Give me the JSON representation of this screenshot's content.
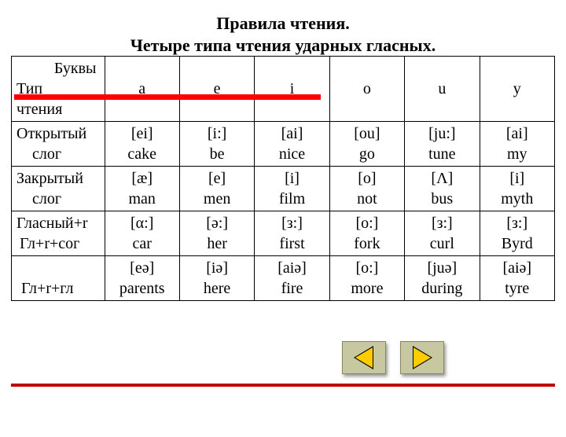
{
  "title_line1": "Правила чтения.",
  "title_line2": "Четыре типа чтения ударных гласных.",
  "header": {
    "corner_l1": "Буквы",
    "corner_l2": "Тип",
    "corner_l3": "чтения",
    "vowels": [
      "a",
      "e",
      "i",
      "o",
      "u",
      "y"
    ]
  },
  "rows": [
    {
      "label_l1": "Открытый",
      "label_l2": "слог",
      "cells": [
        {
          "ipa": "[ei]",
          "ex": "cake"
        },
        {
          "ipa": "[i:]",
          "ex": "be"
        },
        {
          "ipa": "[ai]",
          "ex": "nice"
        },
        {
          "ipa": "[ou]",
          "ex": "go"
        },
        {
          "ipa": "[ju:]",
          "ex": "tune"
        },
        {
          "ipa": "[ai]",
          "ex": "my"
        }
      ]
    },
    {
      "label_l1": "Закрытый",
      "label_l2": "слог",
      "cells": [
        {
          "ipa": "[æ]",
          "ex": "man"
        },
        {
          "ipa": "[e]",
          "ex": "men"
        },
        {
          "ipa": "[i]",
          "ex": "film"
        },
        {
          "ipa": "[o]",
          "ex": "not"
        },
        {
          "ipa": "[Λ]",
          "ex": "bus"
        },
        {
          "ipa": "[i]",
          "ex": "myth"
        }
      ]
    },
    {
      "label_l1": "Гласный+r",
      "label_l2": "Гл+r+сог",
      "cells": [
        {
          "ipa": "[α:]",
          "ex": "car"
        },
        {
          "ipa": "[ə:]",
          "ex": "her"
        },
        {
          "ipa": "[з:]",
          "ex": "first"
        },
        {
          "ipa": "[o:]",
          "ex": "fork"
        },
        {
          "ipa": "[з:]",
          "ex": "curl"
        },
        {
          "ipa": "[з:]",
          "ex": "Byrd"
        }
      ]
    },
    {
      "label_l1": "",
      "label_l2": "Гл+r+гл",
      "cells": [
        {
          "ipa": "[eә]",
          "ex": "parents"
        },
        {
          "ipa": "[iә]",
          "ex": "here"
        },
        {
          "ipa": "[aiә]",
          "ex": "fire"
        },
        {
          "ipa": "[o:]",
          "ex": "more"
        },
        {
          "ipa": "[juә]",
          "ex": "during"
        },
        {
          "ipa": "[aiә]",
          "ex": "tyre"
        }
      ]
    }
  ],
  "chart_data": {
    "type": "table",
    "title": "Правила чтения. Четыре типа чтения ударных гласных.",
    "columns": [
      "Тип чтения / Буквы",
      "a",
      "e",
      "i",
      "o",
      "u",
      "y"
    ],
    "rows": [
      [
        "Открытый слог",
        "[ei] cake",
        "[i:] be",
        "[ai] nice",
        "[ou] go",
        "[ju:] tune",
        "[ai] my"
      ],
      [
        "Закрытый слог",
        "[æ] man",
        "[e] men",
        "[i] film",
        "[o] not",
        "[Λ] bus",
        "[i] myth"
      ],
      [
        "Гласный+r / Гл+r+сог",
        "[α:] car",
        "[ə:] her",
        "[з:] first",
        "[o:] fork",
        "[з:] curl",
        "[з:] Byrd"
      ],
      [
        "Гл+r+гл",
        "[eә] parents",
        "[iә] here",
        "[aiә] fire",
        "[o:] more",
        "[juә] during",
        "[aiә] tyre"
      ]
    ]
  }
}
